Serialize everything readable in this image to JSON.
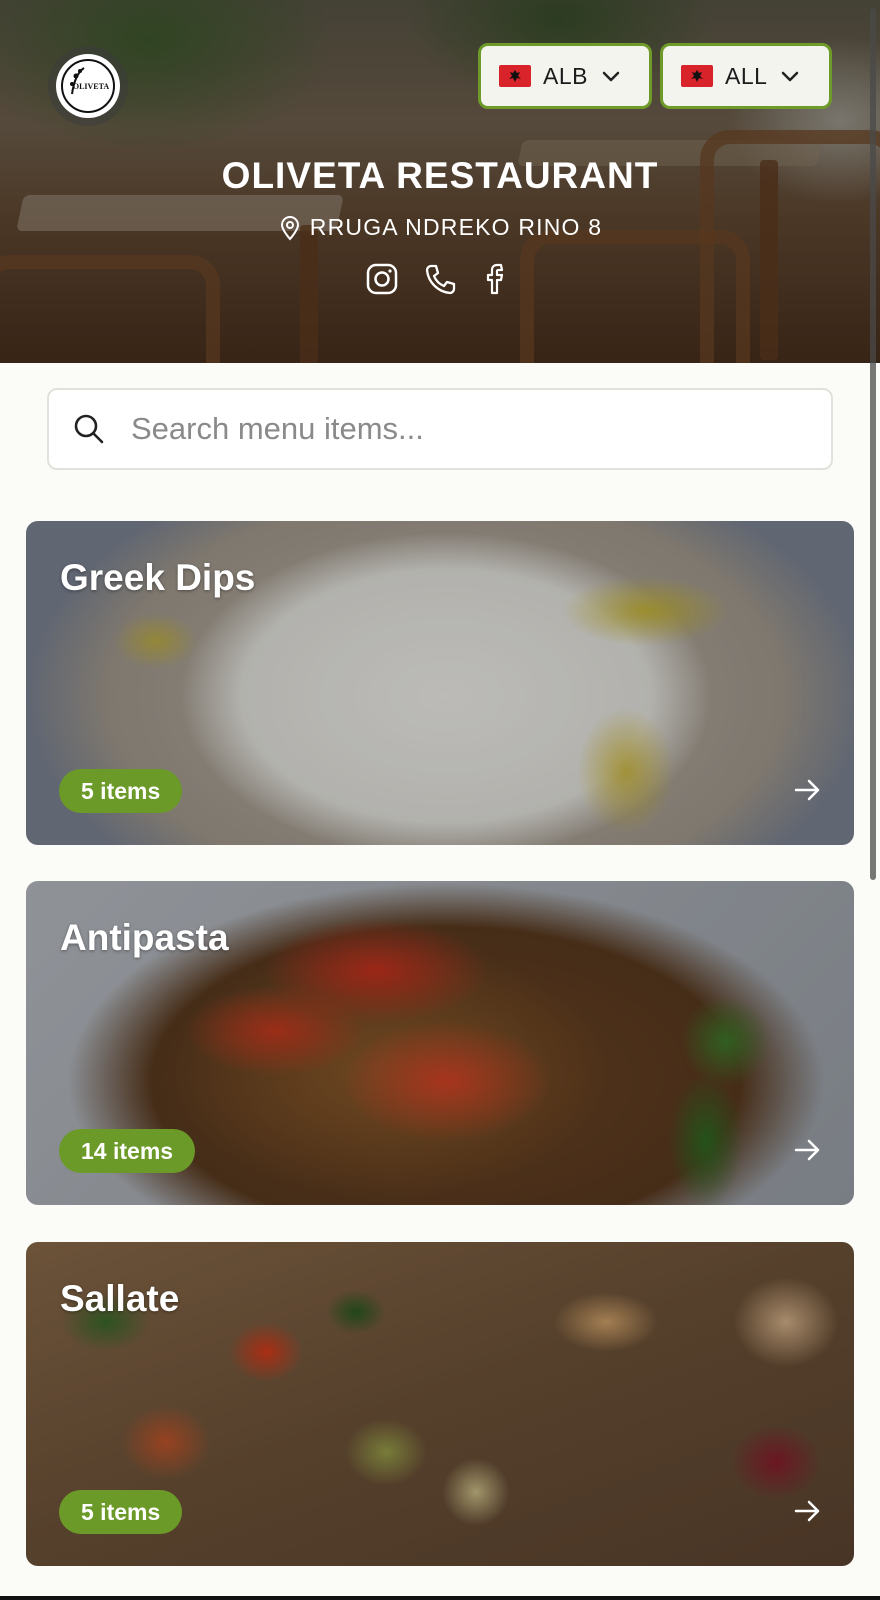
{
  "header": {
    "logo_text": "OLIVETA",
    "restaurant_name": "OLIVETA RESTAURANT",
    "address": "RRUGA NDREKO RINO 8",
    "language_select": {
      "label": "ALB",
      "flag": "albania-flag-icon"
    },
    "currency_select": {
      "label": "ALL",
      "flag": "albania-flag-icon"
    },
    "socials": [
      "instagram-icon",
      "phone-icon",
      "facebook-icon"
    ]
  },
  "search": {
    "placeholder": "Search menu items..."
  },
  "categories": [
    {
      "name": "Greek Dips",
      "count": "5 items"
    },
    {
      "name": "Antipasta",
      "count": "14 items"
    },
    {
      "name": "Sallate",
      "count": "5 items"
    }
  ],
  "colors": {
    "accent": "#6b9a28",
    "select_border": "#6e9a2a",
    "background": "#fbfbf7"
  }
}
